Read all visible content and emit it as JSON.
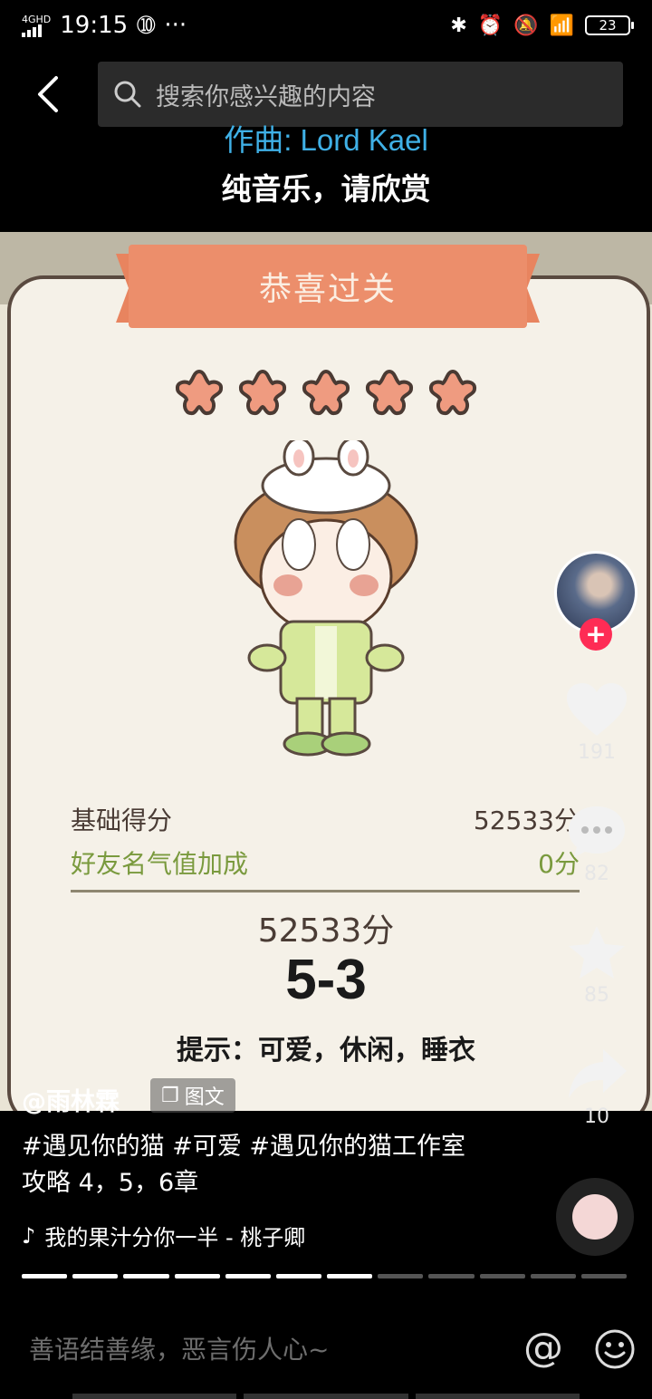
{
  "status_bar": {
    "network": "4GHD",
    "time": "19:15",
    "more": "···",
    "battery": "23"
  },
  "search": {
    "placeholder": "搜索你感兴趣的内容"
  },
  "overlay": {
    "credit": "作曲: Lord Kael",
    "subtitle": "纯音乐，请欣赏"
  },
  "game_card": {
    "banner": "恭喜过关",
    "stars": 5,
    "base_score_label": "基础得分",
    "base_score_value": "52533分",
    "bonus_label": "好友名气值加成",
    "bonus_value": "0分",
    "total": "52533分",
    "level": "5-3",
    "hint": "提示：可爱，休闲，睡衣"
  },
  "post": {
    "author": "@雨林霖",
    "type_label": "图文",
    "description": "#遇见你的猫 #可爱 #遇见你的猫工作室攻略 4，5，6章",
    "music": "我的果汁分你一半 - 桃子卿"
  },
  "actions": {
    "likes": "191",
    "comments": "82",
    "favorites": "85",
    "shares": "10",
    "follow": "+"
  },
  "progress": {
    "total_segments": 12,
    "active_segments": 7
  },
  "comment_bar": {
    "placeholder": "善语结善缘，恶言伤人心~",
    "at": "@"
  },
  "colors": {
    "accent_red": "#fe2c55",
    "banner": "#ec8e6b",
    "credit_blue": "#3fb0e6",
    "bonus_green": "#7a9a3e"
  }
}
